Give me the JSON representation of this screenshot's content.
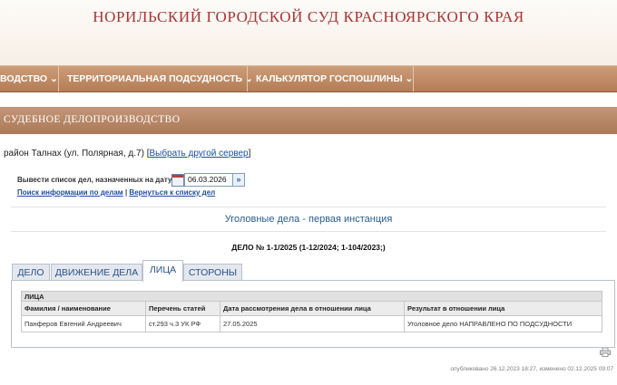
{
  "header": {
    "title": "НОРИЛЬСКИЙ ГОРОДСКОЙ СУД КРАСНОЯРСКОГО КРАЯ"
  },
  "nav": {
    "items": [
      {
        "label": "ВОДСТВО ⌄"
      },
      {
        "label": "ТЕРРИТОРИАЛЬНАЯ ПОДСУДНОСТЬ ⌄"
      },
      {
        "label": "КАЛЬКУЛЯТОР ГОСПОШЛИНЫ ⌄"
      }
    ]
  },
  "section": {
    "title": "СУДЕБНОЕ ДЕЛОПРОИЗВОДСТВО"
  },
  "district": {
    "text": "район Талнах (ул. Полярная, д.7)",
    "bracket_open": "[",
    "link": "Выбрать другой сервер",
    "bracket_close": "]"
  },
  "date_filter": {
    "label": "Вывести список дел, назначенных на дату",
    "value": "06.03.2026",
    "go": "»"
  },
  "links": {
    "search": "Поиск информации по делам",
    "separator": "|",
    "back": "Вернуться к списку дел"
  },
  "case": {
    "type": "Уголовные дела - первая инстанция",
    "number": "ДЕЛО № 1-1/2025 (1-12/2024; 1-104/2023;)"
  },
  "tabs": [
    {
      "label": "ДЕЛО"
    },
    {
      "label": "ДВИЖЕНИЕ ДЕЛА"
    },
    {
      "label": "ЛИЦА",
      "active": true
    },
    {
      "label": "СТОРОНЫ"
    }
  ],
  "table": {
    "caption": "ЛИЦА",
    "columns": [
      "Фамилия / наименование",
      "Перечень статей",
      "Дата рассмотрения дела в отношении лица",
      "Результат в отношении лица"
    ],
    "rows": [
      [
        "Панферов Евгений Андреевич",
        "ст.293 ч.3 УК РФ",
        "27.05.2025",
        "Уголовное дело НАПРАВЛЕНО ПО ПОДСУДНОСТИ"
      ]
    ]
  },
  "footer": {
    "published": "опубликовано 26.12.2023 18:27, изменено 02.12.2025 09:07"
  },
  "colors": {
    "title_red": "#a63535",
    "nav_brown": "#b47c55",
    "link_blue": "#1e4fa0",
    "tab_blue": "#2a5088"
  },
  "icons": [
    "calendar-icon",
    "double-arrow-icon",
    "chevron-down-icon",
    "printer-icon"
  ]
}
